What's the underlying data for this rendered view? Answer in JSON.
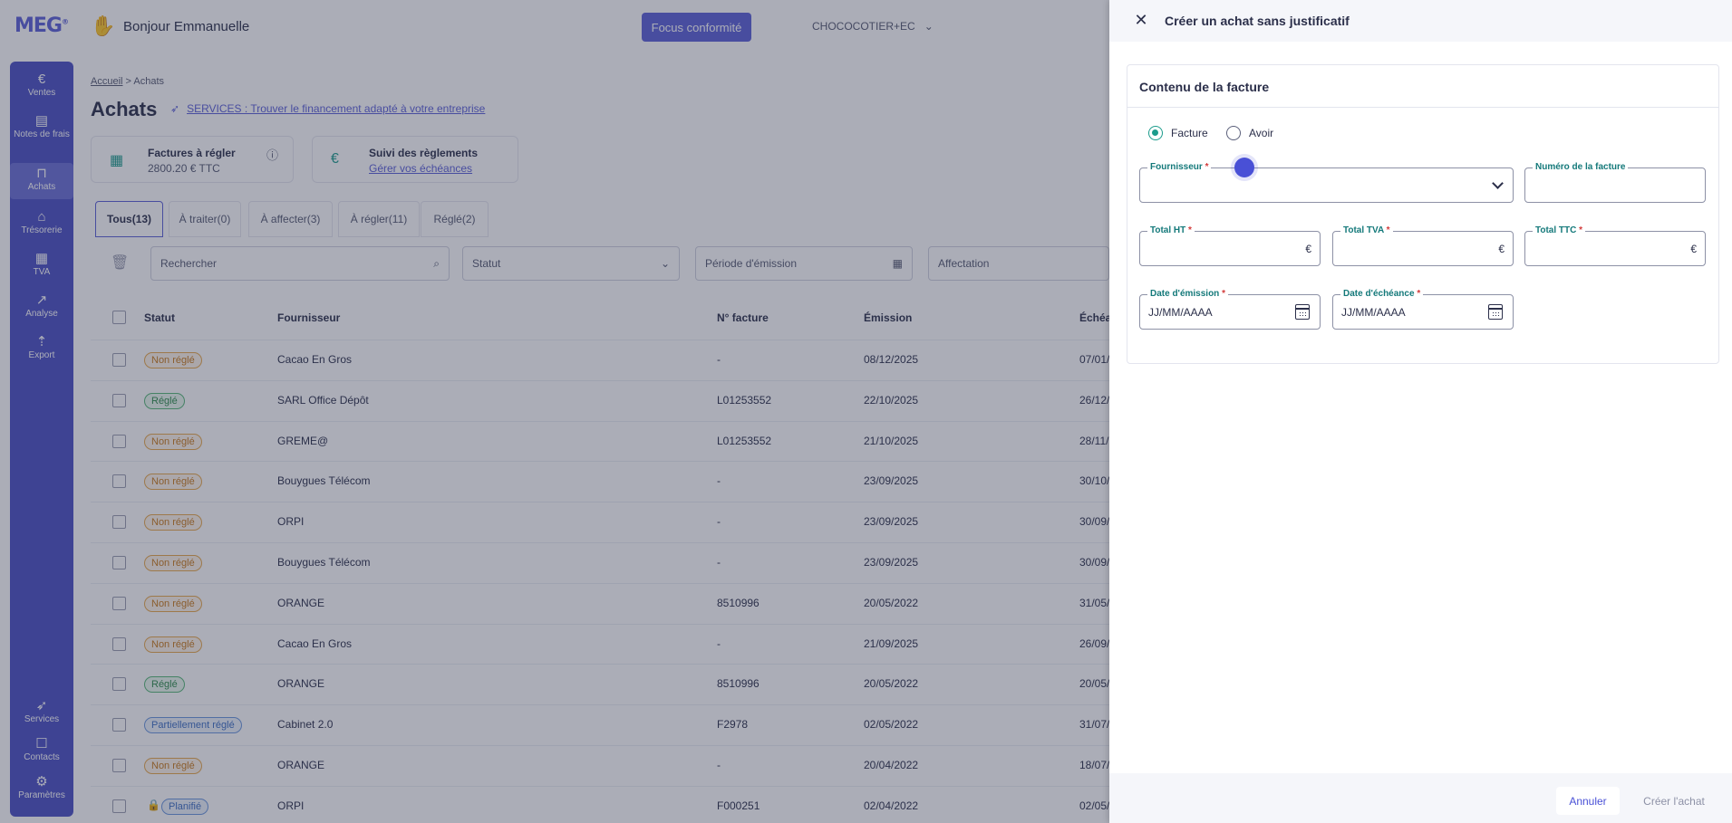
{
  "app": {
    "logo": "MEG",
    "greeting": "Bonjour Emmanuelle",
    "focus_button": "Focus conformité",
    "company": "CHOCOCOTIER+EC"
  },
  "sidebar": {
    "items": [
      {
        "label": "Ventes",
        "icon": "euro-icon"
      },
      {
        "label": "Notes de frais",
        "icon": "receipt-icon"
      },
      {
        "label": "Achats",
        "icon": "bag-icon"
      },
      {
        "label": "Trésorerie",
        "icon": "bank-icon"
      },
      {
        "label": "TVA",
        "icon": "calculator-icon"
      },
      {
        "label": "Analyse",
        "icon": "chart-icon"
      },
      {
        "label": "Export",
        "icon": "upload-icon"
      },
      {
        "label": "Services",
        "icon": "rocket-icon"
      },
      {
        "label": "Contacts",
        "icon": "contact-icon"
      },
      {
        "label": "Paramètres",
        "icon": "gear-icon"
      }
    ]
  },
  "page": {
    "breadcrumb_home": "Accueil",
    "breadcrumb_sep": ">",
    "breadcrumb_current": "Achats",
    "title": "Achats",
    "services_link": "SERVICES : Trouver le financement adapté à votre entreprise",
    "cards": {
      "to_pay_title": "Factures à régler",
      "to_pay_amount": "2800.20 € TTC",
      "tracking_title": "Suivi des règlements",
      "tracking_link": "Gérer vos échéances"
    },
    "tabs": [
      "Tous(13)",
      "À traiter(0)",
      "À affecter(3)",
      "À régler(11)",
      "Réglé(2)"
    ],
    "filters": {
      "search_placeholder": "Rechercher",
      "status": "Statut",
      "period": "Période d'émission",
      "assignment": "Affectation"
    },
    "columns": [
      "Statut",
      "Fournisseur",
      "N° facture",
      "Émission",
      "Échéa"
    ],
    "rows": [
      {
        "status": "Non réglé",
        "supplier": "Cacao En Gros",
        "number": "-",
        "date": "08/12/2025",
        "due": "07/01/"
      },
      {
        "status": "Réglé",
        "supplier": "SARL Office Dépôt",
        "number": "L01253552",
        "date": "22/10/2025",
        "due": "26/12/"
      },
      {
        "status": "Non réglé",
        "supplier": "GREME@",
        "number": "L01253552",
        "date": "21/10/2025",
        "due": "28/11/"
      },
      {
        "status": "Non réglé",
        "supplier": "Bouygues Télécom",
        "number": "-",
        "date": "23/09/2025",
        "due": "30/10/"
      },
      {
        "status": "Non réglé",
        "supplier": "ORPI",
        "number": "-",
        "date": "23/09/2025",
        "due": "30/09/"
      },
      {
        "status": "Non réglé",
        "supplier": "Bouygues Télécom",
        "number": "-",
        "date": "23/09/2025",
        "due": "30/09/"
      },
      {
        "status": "Non réglé",
        "supplier": "ORANGE",
        "number": "8510996",
        "date": "20/05/2022",
        "due": "31/05/"
      },
      {
        "status": "Non réglé",
        "supplier": "Cacao En Gros",
        "number": "-",
        "date": "21/09/2025",
        "due": "26/09/"
      },
      {
        "status": "Réglé",
        "supplier": "ORANGE",
        "number": "8510996",
        "date": "20/05/2022",
        "due": "20/05/"
      },
      {
        "status": "Partiellement réglé",
        "supplier": "Cabinet 2.0",
        "number": "F2978",
        "date": "02/05/2022",
        "due": "31/07/"
      },
      {
        "status": "Non réglé",
        "supplier": "ORANGE",
        "number": "-",
        "date": "20/04/2022",
        "due": "18/07/"
      },
      {
        "status": "Planifié",
        "supplier": "ORPI",
        "number": "F000251",
        "date": "02/04/2022",
        "due": "02/05/"
      }
    ]
  },
  "drawer": {
    "title": "Créer un achat sans justificatif",
    "section_title": "Contenu de la facture",
    "radio_invoice": "Facture",
    "radio_credit": "Avoir",
    "supplier_label": "Fournisseur",
    "invoice_number_label": "Numéro de la facture",
    "total_ht_label": "Total HT",
    "total_tva_label": "Total TVA",
    "total_ttc_label": "Total TTC",
    "currency": "€",
    "issue_date_label": "Date d'émission",
    "due_date_label": "Date d'échéance",
    "date_placeholder": "JJ/MM/AAAA",
    "required_mark": "*",
    "cancel_button": "Annuler",
    "create_button": "Créer l'achat"
  }
}
